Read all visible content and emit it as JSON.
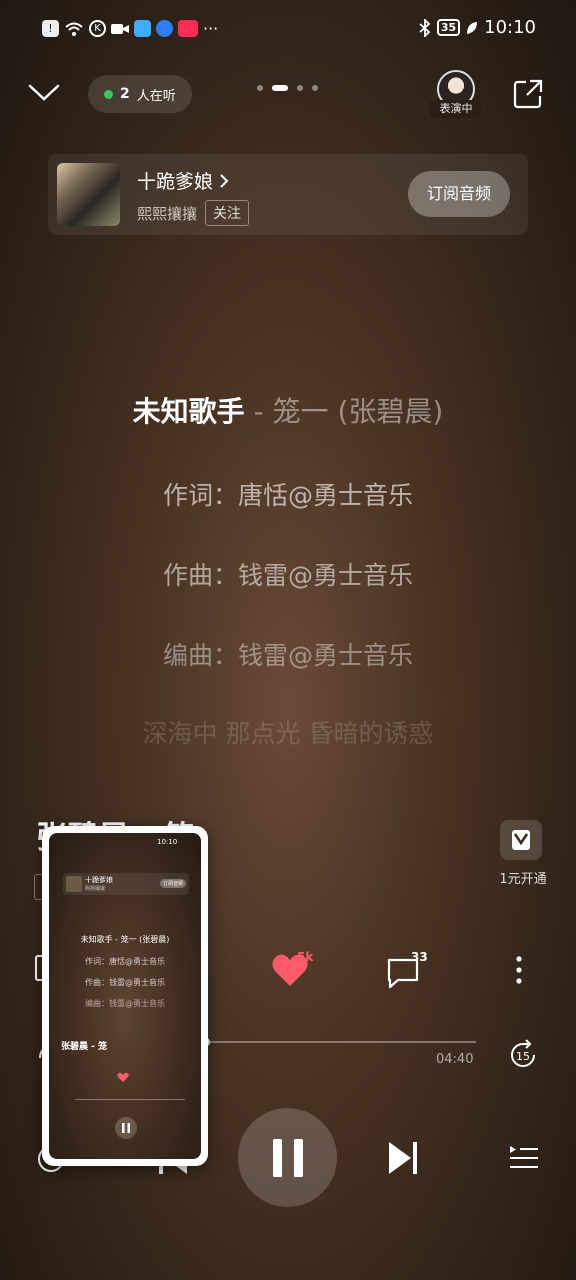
{
  "status_bar": {
    "time": "10:10",
    "battery": "35",
    "icons": [
      "alert-icon",
      "wifi-icon",
      "k-icon",
      "video-icon",
      "app-icon",
      "app-icon",
      "app-icon",
      "more-icon"
    ]
  },
  "top_bar": {
    "listeners_count": "2",
    "listeners_text": "人在听",
    "performer_tag": "表演中",
    "page_count": 4,
    "active_page": 1
  },
  "album": {
    "title": "十跪爹娘",
    "artist": "熙熙攘攘",
    "follow_label": "关注",
    "subscribe_label": "订阅音频"
  },
  "lyrics": {
    "title_artist": "未知歌手",
    "title_rest": " - 笼一 (张碧晨)",
    "lines": [
      "作词：唐恬@勇士音乐",
      "作曲：钱雷@勇士音乐",
      "编曲：钱雷@勇士音乐",
      "深海中 那点光 昏暗的诱惑"
    ]
  },
  "song": {
    "title_visible": "张碧晨 - 笼",
    "vip_label": "1元开通"
  },
  "actions": {
    "like_count": "5k",
    "comment_count": "33"
  },
  "player": {
    "duration": "04:40",
    "forward_seconds": "15",
    "progress": 0.0,
    "state": "playing"
  },
  "thumbnail": {
    "album_title": "十跪爹娘",
    "album_artist": "熙熙攘攘",
    "subscribe_label": "订阅音频",
    "lyric_title": "未知歌手 - 笼一 (张碧晨)",
    "lines": [
      "作词：唐恬@勇士音乐",
      "作曲：钱雷@勇士音乐",
      "编曲：钱雷@勇士音乐"
    ],
    "song_title": "张碧晨 - 笼",
    "time": "10:10"
  },
  "colors": {
    "accent_like": "#ff5a6a",
    "online_dot": "#35c759",
    "background": "#3e2c20"
  }
}
